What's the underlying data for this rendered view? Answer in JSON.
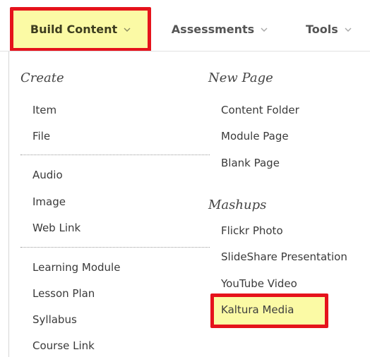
{
  "toolbar": {
    "build_content": "Build Content",
    "assessments": "Assessments",
    "tools": "Tools"
  },
  "menu": {
    "create": {
      "heading": "Create",
      "group1": [
        "Item",
        "File"
      ],
      "group2": [
        "Audio",
        "Image",
        "Web Link"
      ],
      "group3": [
        "Learning Module",
        "Lesson Plan",
        "Syllabus",
        "Course Link"
      ]
    },
    "new_page": {
      "heading": "New Page",
      "items": [
        "Content Folder",
        "Module Page",
        "Blank Page"
      ]
    },
    "mashups": {
      "heading": "Mashups",
      "items": [
        "Flickr Photo",
        "SlideShare Presentation",
        "YouTube Video",
        "Kaltura Media"
      ]
    }
  },
  "colors": {
    "highlight_fill": "#fbfaa5",
    "highlight_border": "#e5131c"
  },
  "icons": {
    "dropdown": "chevron-down-icon"
  }
}
